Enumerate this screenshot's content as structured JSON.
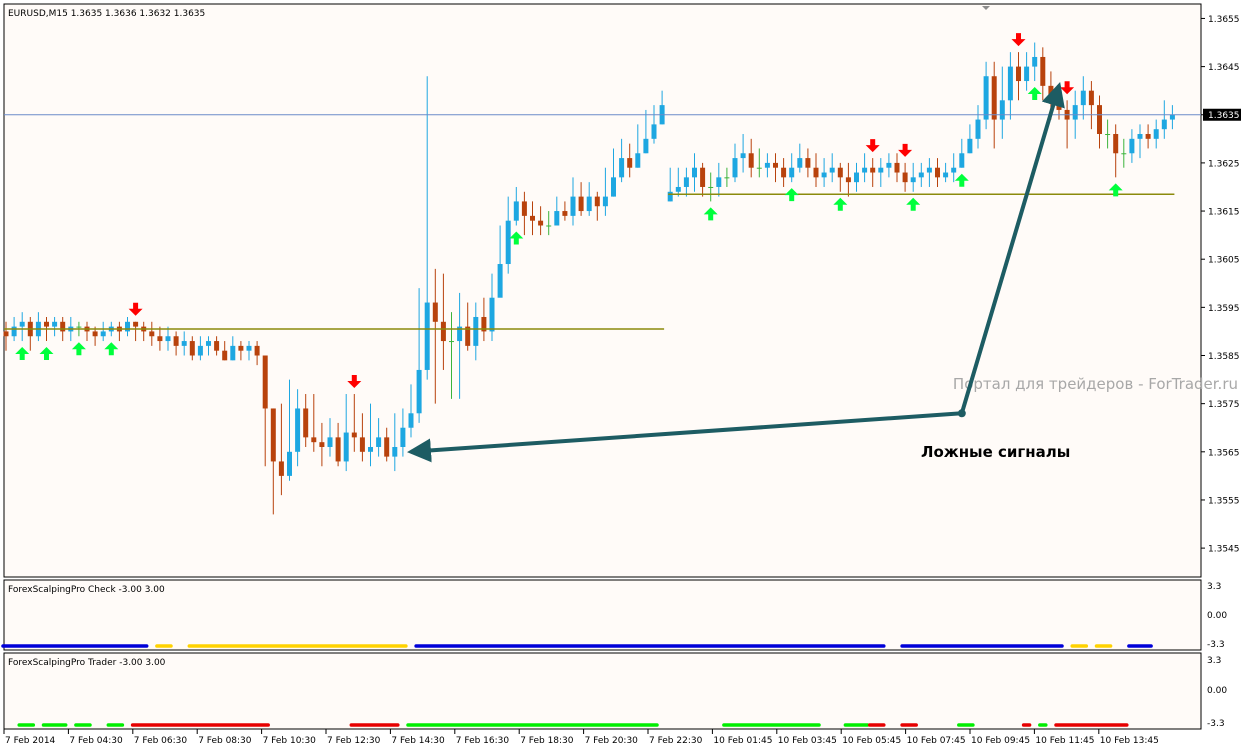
{
  "window": {
    "symbol_header": "EURUSD,M15  1.3635 1.3636 1.3632 1.3635",
    "current_price_label": "1.3635"
  },
  "colors": {
    "background": "#fffbf8",
    "bull_candle": "#1ea7e1",
    "bear_candle": "#b8420c",
    "neutral_tick": "#3cb43c",
    "level_line": "#8b8a0c",
    "buy_arrow": "#00ff3c",
    "sell_arrow": "#ff0000",
    "annotation_arrow": "#1d5c63",
    "price_line": "#6b8bc9"
  },
  "watermark": "Портал для трейдеров - ForTrader.ru",
  "annotation": {
    "text": "Ложные сигналы"
  },
  "indicator_check": {
    "title": "ForexScalpingPro Check -3.00 3.00",
    "ticks": [
      "3.3",
      "0.00",
      "-3.3"
    ]
  },
  "indicator_trader": {
    "title": "ForexScalpingPro Trader -3.00 3.00",
    "ticks": [
      "3.3",
      "0.00",
      "-3.3"
    ]
  },
  "chart_data": [
    {
      "type": "candlestick",
      "title": "EURUSD,M15  1.3635 1.3636 1.3632 1.3635",
      "y_ticks": [
        "1.3655",
        "1.3645",
        "1.3635",
        "1.3625",
        "1.3615",
        "1.3605",
        "1.3595",
        "1.3585",
        "1.3575",
        "1.3565",
        "1.3555",
        "1.3545"
      ],
      "ylim": [
        1.3539,
        1.3658
      ],
      "x_ticks": [
        "7 Feb 2014",
        "7 Feb 04:30",
        "7 Feb 06:30",
        "7 Feb 08:30",
        "7 Feb 10:30",
        "7 Feb 12:30",
        "7 Feb 14:30",
        "7 Feb 16:30",
        "7 Feb 18:30",
        "7 Feb 20:30",
        "7 Feb 22:30",
        "10 Feb 01:45",
        "10 Feb 03:45",
        "10 Feb 05:45",
        "10 Feb 07:45",
        "10 Feb 09:45",
        "10 Feb 11:45",
        "10 Feb 13:45"
      ],
      "current_price": 1.3635,
      "segments": [
        {
          "start_index": 0,
          "closes": [
            1.3589,
            1.3591,
            1.3592,
            1.3589,
            1.3592,
            1.3591,
            1.3592,
            1.359,
            1.3591,
            1.3591,
            1.359,
            1.3589,
            1.359,
            1.3591,
            1.359,
            1.3592,
            1.3591,
            1.359,
            1.3589,
            1.3588,
            1.3589,
            1.3587,
            1.3588,
            1.3585,
            1.3587,
            1.3588,
            1.3586,
            1.3584,
            1.3587,
            1.3586,
            1.3587,
            1.3585,
            1.3574,
            1.3563,
            1.356,
            1.3565,
            1.3574,
            1.3568,
            1.3567,
            1.3566,
            1.3568,
            1.3563,
            1.3569,
            1.3568,
            1.3565,
            1.3566,
            1.3568,
            1.3564,
            1.3566,
            1.357,
            1.3573,
            1.3582,
            1.3596,
            1.3592,
            1.3588,
            1.3588,
            1.3591,
            1.3587,
            1.3593,
            1.359,
            1.3597,
            1.3604,
            1.3613,
            1.3617,
            1.3614,
            1.3613,
            1.3612,
            1.3612,
            1.3615,
            1.3614,
            1.3618,
            1.3615,
            1.3618,
            1.3616,
            1.3618,
            1.3622,
            1.3626,
            1.3624,
            1.3627,
            1.363,
            1.3633,
            1.3637
          ],
          "highs": [
            1.3592,
            1.3593,
            1.3594,
            1.3593,
            1.3594,
            1.3593,
            1.3593,
            1.3593,
            1.3593,
            1.3592,
            1.3592,
            1.3591,
            1.3592,
            1.3592,
            1.3592,
            1.3593,
            1.3592,
            1.3592,
            1.3592,
            1.3591,
            1.3591,
            1.359,
            1.359,
            1.3589,
            1.3589,
            1.3589,
            1.3589,
            1.3588,
            1.3589,
            1.3588,
            1.3588,
            1.3588,
            1.3583,
            1.3574,
            1.3575,
            1.358,
            1.3578,
            1.3577,
            1.3577,
            1.3571,
            1.3572,
            1.3571,
            1.3577,
            1.3577,
            1.3573,
            1.3575,
            1.3572,
            1.357,
            1.3573,
            1.3574,
            1.3579,
            1.3599,
            1.3643,
            1.3603,
            1.3602,
            1.3594,
            1.3598,
            1.3596,
            1.3596,
            1.3597,
            1.3602,
            1.3612,
            1.3618,
            1.362,
            1.3619,
            1.3617,
            1.3616,
            1.3615,
            1.3618,
            1.3617,
            1.3622,
            1.3621,
            1.3621,
            1.3619,
            1.3624,
            1.3628,
            1.363,
            1.3629,
            1.3633,
            1.3636,
            1.3637,
            1.364
          ],
          "lows": [
            1.3586,
            1.3588,
            1.3588,
            1.3586,
            1.3588,
            1.3588,
            1.3589,
            1.3588,
            1.3588,
            1.3589,
            1.3588,
            1.3587,
            1.3588,
            1.3589,
            1.3588,
            1.3589,
            1.3588,
            1.3588,
            1.3587,
            1.3586,
            1.3586,
            1.3585,
            1.3585,
            1.3584,
            1.3584,
            1.3585,
            1.3585,
            1.3584,
            1.3584,
            1.3584,
            1.3584,
            1.3583,
            1.3562,
            1.3552,
            1.3556,
            1.3559,
            1.3562,
            1.3566,
            1.3565,
            1.3562,
            1.3564,
            1.3562,
            1.3561,
            1.3565,
            1.3563,
            1.3562,
            1.3564,
            1.3563,
            1.3561,
            1.3564,
            1.3568,
            1.3571,
            1.358,
            1.3575,
            1.3582,
            1.3576,
            1.3576,
            1.3586,
            1.3584,
            1.3588,
            1.3588,
            1.3598,
            1.3602,
            1.3612,
            1.361,
            1.361,
            1.361,
            1.361,
            1.3612,
            1.3613,
            1.3612,
            1.3614,
            1.3614,
            1.3613,
            1.3614,
            1.3618,
            1.3621,
            1.3622,
            1.3624,
            1.3627,
            1.3629,
            1.3633
          ],
          "opens_first": 1.359
        },
        {
          "start_index": 82,
          "closes": [
            1.3619,
            1.362,
            1.3622,
            1.3624,
            1.362,
            1.362,
            1.3622,
            1.3622,
            1.3626,
            1.3627,
            1.3624,
            1.3624,
            1.3625,
            1.3624,
            1.3622,
            1.3624,
            1.3626,
            1.3624,
            1.3622,
            1.3623,
            1.3624,
            1.3622,
            1.3621,
            1.3623,
            1.3624,
            1.3623,
            1.3624,
            1.3625,
            1.3623,
            1.3621,
            1.3622,
            1.3623,
            1.3624,
            1.3622,
            1.3623,
            1.3624,
            1.3627,
            1.363,
            1.3634,
            1.3643,
            1.3634,
            1.3638,
            1.3645,
            1.3642,
            1.3645,
            1.3647,
            1.3641,
            1.3639,
            1.3636,
            1.3634,
            1.3637,
            1.364,
            1.3637,
            1.3631,
            1.3631,
            1.3627,
            1.3627,
            1.363,
            1.3631,
            1.363,
            1.3632,
            1.3634,
            1.3635
          ],
          "highs": [
            1.3624,
            1.3624,
            1.3624,
            1.3627,
            1.3625,
            1.3623,
            1.3625,
            1.3624,
            1.3629,
            1.3631,
            1.363,
            1.3628,
            1.3627,
            1.3627,
            1.3626,
            1.3627,
            1.3629,
            1.3628,
            1.3627,
            1.3626,
            1.3627,
            1.3625,
            1.3625,
            1.3625,
            1.3627,
            1.3626,
            1.3626,
            1.3627,
            1.3627,
            1.3625,
            1.3625,
            1.3625,
            1.3626,
            1.3626,
            1.3625,
            1.3627,
            1.363,
            1.3633,
            1.3637,
            1.3646,
            1.3646,
            1.3645,
            1.3648,
            1.3648,
            1.3648,
            1.365,
            1.3649,
            1.3644,
            1.3641,
            1.3638,
            1.364,
            1.3643,
            1.3642,
            1.3639,
            1.3634,
            1.3633,
            1.363,
            1.3632,
            1.3633,
            1.3633,
            1.3634,
            1.3638,
            1.3637
          ],
          "lows": [
            1.3617,
            1.3618,
            1.3618,
            1.3619,
            1.3618,
            1.3617,
            1.3618,
            1.362,
            1.3621,
            1.3623,
            1.3622,
            1.3622,
            1.3622,
            1.3621,
            1.362,
            1.3621,
            1.3623,
            1.3622,
            1.362,
            1.362,
            1.3621,
            1.3619,
            1.3618,
            1.3619,
            1.3621,
            1.362,
            1.362,
            1.3622,
            1.3621,
            1.3619,
            1.3619,
            1.362,
            1.362,
            1.362,
            1.3621,
            1.3621,
            1.3624,
            1.3627,
            1.3628,
            1.3632,
            1.3628,
            1.363,
            1.3634,
            1.3638,
            1.364,
            1.3642,
            1.3638,
            1.3634,
            1.3634,
            1.3628,
            1.363,
            1.3634,
            1.3632,
            1.3628,
            1.3628,
            1.3622,
            1.3624,
            1.3625,
            1.3626,
            1.3628,
            1.3628,
            1.363,
            1.3632
          ],
          "opens_first": 1.3617
        }
      ],
      "levels": [
        {
          "price": 1.35905,
          "from_index": 0,
          "to_index": 81
        },
        {
          "price": 1.36185,
          "from_index": 82,
          "to_index": 144
        }
      ],
      "buy_arrows": [
        2,
        5,
        9,
        13,
        63,
        87,
        97,
        103,
        112,
        118,
        127,
        137
      ],
      "sell_arrows": [
        16,
        43,
        107,
        111,
        125,
        131
      ],
      "annotation_targets": [
        {
          "index": 50,
          "price": 1.3565
        },
        {
          "index": 130,
          "price": 1.3641
        }
      ],
      "annotation_origin": {
        "index": 118,
        "price": 1.3573
      }
    },
    {
      "type": "histogram",
      "title": "ForexScalpingPro Check -3.00 3.00",
      "ylim": [
        -3.3,
        3.3
      ],
      "level": -3.3,
      "series": [
        {
          "name": "blue",
          "color": "#0000d8",
          "segments": [
            [
              0,
              17
            ],
            [
              51,
              108
            ],
            [
              111,
              130
            ],
            [
              139,
              141
            ]
          ]
        },
        {
          "name": "gold",
          "color": "#ffd200",
          "segments": [
            [
              19,
              20
            ],
            [
              23,
              49
            ],
            [
              132,
              133
            ],
            [
              135,
              136
            ]
          ]
        }
      ]
    },
    {
      "type": "histogram",
      "title": "ForexScalpingPro Trader -3.00 3.00",
      "ylim": [
        -3.3,
        3.3
      ],
      "level": -3.3,
      "series": [
        {
          "name": "green",
          "color": "#00ee00",
          "segments": [
            [
              2,
              3
            ],
            [
              5,
              7
            ],
            [
              9,
              10
            ],
            [
              13,
              14
            ],
            [
              50,
              80
            ],
            [
              89,
              100
            ],
            [
              104,
              106
            ],
            [
              118,
              119
            ],
            [
              128,
              128
            ]
          ]
        },
        {
          "name": "red",
          "color": "#e60000",
          "segments": [
            [
              16,
              32
            ],
            [
              43,
              48
            ],
            [
              107,
              108
            ],
            [
              111,
              112
            ],
            [
              126,
              126
            ],
            [
              130,
              138
            ]
          ]
        }
      ]
    }
  ]
}
